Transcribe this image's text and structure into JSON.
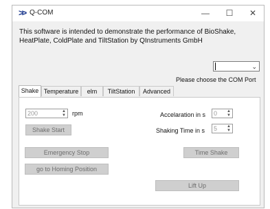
{
  "window": {
    "title": "Q-COM",
    "app_icon": "chevrons-right-icon",
    "minimize": "—",
    "maximize": "☐",
    "close": "✕"
  },
  "description": "This software is intended to demonstrate the performance of BioShake, HeatPlate, ColdPlate and TiltStation by QInstruments GmbH",
  "com_port": {
    "value": "",
    "label": "Please choose the COM Port"
  },
  "tabs": [
    "Shake",
    "Temperature",
    "elm",
    "TiltStation",
    "Advanced"
  ],
  "shake": {
    "rpm_value": "200",
    "rpm_unit": "rpm",
    "shake_start": "Shake Start",
    "accel_label": "Accelaration in s",
    "accel_value": "0",
    "time_label": "Shaking Time in s",
    "time_value": "5",
    "emergency_stop": "Emergency Stop",
    "homing": "go to Homing Position",
    "time_shake": "Time Shake",
    "lift_up": "Lift Up"
  }
}
